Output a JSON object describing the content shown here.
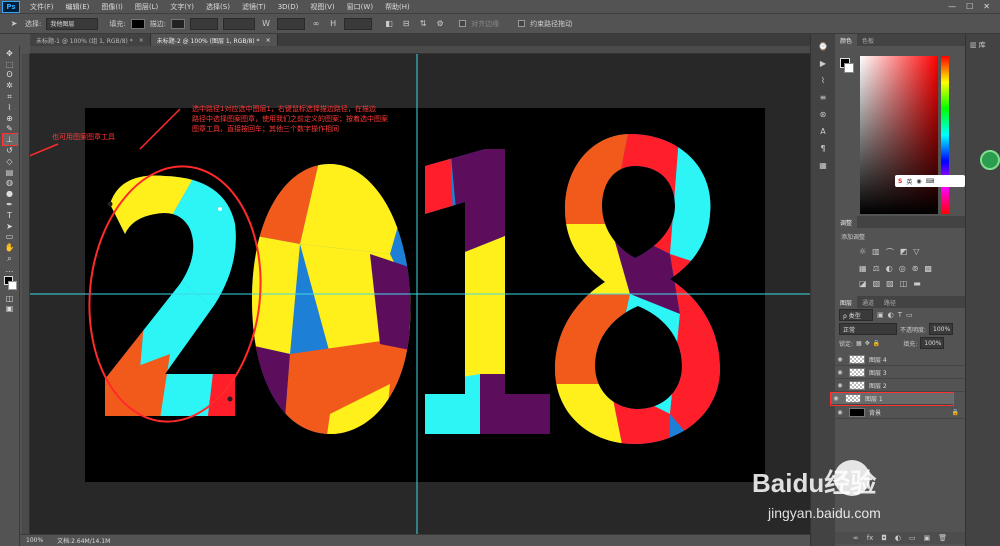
{
  "app": {
    "logo": "Ps"
  },
  "menu": [
    "文件(F)",
    "编辑(E)",
    "图像(I)",
    "图层(L)",
    "文字(Y)",
    "选择(S)",
    "滤镜(T)",
    "3D(D)",
    "视图(V)",
    "窗口(W)",
    "帮助(H)"
  ],
  "window_controls": {
    "minimize": "—",
    "maximize": "☐",
    "close": "✕"
  },
  "options": {
    "select_label": "选择:",
    "select_value": "我他图层",
    "fill_label": "填充:",
    "stroke_label": "描边:",
    "align_label": "对齐边缘",
    "constrain_label": "约束路径拖动"
  },
  "tabs": [
    {
      "label": "未标题-1 @ 100% (组 1, RGB/8) *",
      "close": "×"
    },
    {
      "label": "未标题-2 @ 100% (图层 1, RGB/8) *",
      "close": "×"
    }
  ],
  "annotations": {
    "left_note": "也可用图案图章工具",
    "top_note_1": "选中路径1对应选中图层1，右键鼠标选择描边路径，在描边",
    "top_note_2": "路径中选择图案图章，使用我们之前定义的图案；按着选中图案",
    "top_note_3": "图章工具，直接按回车；其他三个数字操作相同"
  },
  "artwork": {
    "text": "2018"
  },
  "status": {
    "zoom": "100%",
    "doc": "文档:2.64M/14.1M"
  },
  "panels": {
    "color_tabs": [
      "颜色",
      "色板"
    ],
    "adjust_tab": "调整",
    "adjust_title": "添加调整",
    "layers_tabs": [
      "图层",
      "通道",
      "路径"
    ],
    "filter_kind": "ρ 类型",
    "blend_mode": "正常",
    "opacity_label": "不透明度:",
    "opacity_value": "100%",
    "lock_label": "锁定:",
    "fill_label": "填充:",
    "fill_value": "100%",
    "layers": [
      {
        "name": "图层 4"
      },
      {
        "name": "图层 3"
      },
      {
        "name": "图层 2"
      },
      {
        "name": "图层 1"
      },
      {
        "name": "背景"
      }
    ]
  },
  "far_strip": {
    "label": "库",
    "ime": "英"
  },
  "watermark": {
    "brand": "Baidu经验",
    "url": "jingyan.baidu.com"
  },
  "colors": {
    "cyan": "#2ef5f5",
    "red": "#ff1f2a",
    "orange": "#f25a1c",
    "yellow": "#ffef1a",
    "purple": "#5c0d5c",
    "blue": "#1e7fd6",
    "annotation": "#ff3838"
  }
}
